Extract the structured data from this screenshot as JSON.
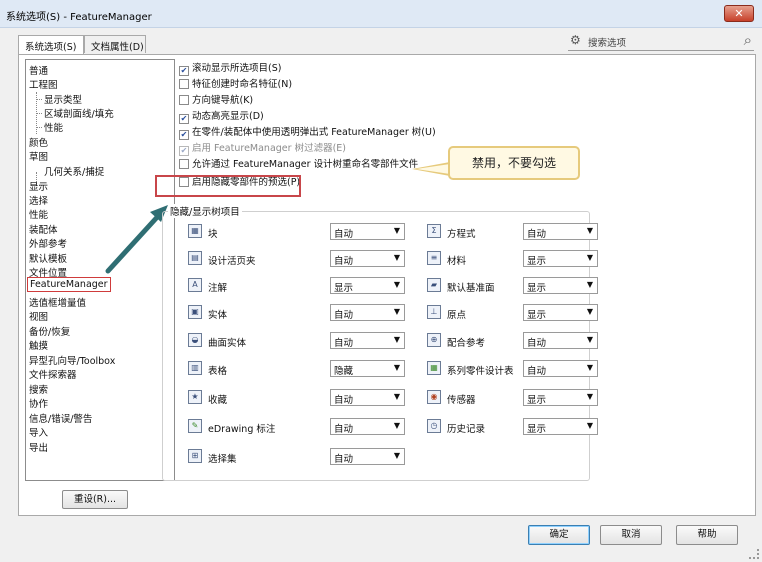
{
  "window": {
    "title": "系统选项(S) - FeatureManager",
    "close_label": "✕"
  },
  "tabs": [
    {
      "label": "系统选项(S)"
    },
    {
      "label": "文档属性(D)"
    }
  ],
  "search": {
    "placeholder": "搜索选项"
  },
  "nav": {
    "items": [
      {
        "label": "普通"
      },
      {
        "label": "工程图"
      },
      {
        "label": "显示类型"
      },
      {
        "label": "区域剖面线/填充"
      },
      {
        "label": "性能"
      },
      {
        "label": "颜色"
      },
      {
        "label": "草图"
      },
      {
        "label": "几何关系/捕捉"
      },
      {
        "label": "显示"
      },
      {
        "label": "选择"
      },
      {
        "label": "性能"
      },
      {
        "label": "装配体"
      },
      {
        "label": "外部参考"
      },
      {
        "label": "默认模板"
      },
      {
        "label": "文件位置"
      },
      {
        "label": "FeatureManager"
      },
      {
        "label": "选值框增量值"
      },
      {
        "label": "视图"
      },
      {
        "label": "备份/恢复"
      },
      {
        "label": "触摸"
      },
      {
        "label": "异型孔向导/Toolbox"
      },
      {
        "label": "文件探索器"
      },
      {
        "label": "搜索"
      },
      {
        "label": "协作"
      },
      {
        "label": "信息/错误/警告"
      },
      {
        "label": "导入"
      },
      {
        "label": "导出"
      }
    ],
    "reset_label": "重设(R)..."
  },
  "options": [
    {
      "label": "滚动显示所选项目(S)",
      "checked": true,
      "disabled": false
    },
    {
      "label": "特征创建时命名特征(N)",
      "checked": false,
      "disabled": false
    },
    {
      "label": "方向键导航(K)",
      "checked": false,
      "disabled": false
    },
    {
      "label": "动态高亮显示(D)",
      "checked": true,
      "disabled": false
    },
    {
      "label": "在零件/装配体中使用透明弹出式 FeatureManager 树(U)",
      "checked": true,
      "disabled": false
    },
    {
      "label": "启用 FeatureManager 树过滤器(E)",
      "checked": true,
      "disabled": true
    },
    {
      "label": "允许通过 FeatureManager 设计树重命名零部件文件",
      "checked": false,
      "disabled": false
    },
    {
      "label": "启用隐藏零部件的预选(P)",
      "checked": false,
      "disabled": false
    }
  ],
  "callout": {
    "text": "禁用，不要勾选"
  },
  "group": {
    "title": "隐藏/显示树项目",
    "items_left": [
      {
        "label": "块",
        "value": "自动",
        "icon": "block-icon"
      },
      {
        "label": "设计活页夹",
        "value": "自动",
        "icon": "design-binder-icon"
      },
      {
        "label": "注解",
        "value": "显示",
        "icon": "annotation-icon"
      },
      {
        "label": "实体",
        "value": "自动",
        "icon": "solid-body-icon"
      },
      {
        "label": "曲面实体",
        "value": "自动",
        "icon": "surface-body-icon"
      },
      {
        "label": "表格",
        "value": "隐藏",
        "icon": "table-icon"
      },
      {
        "label": "收藏",
        "value": "自动",
        "icon": "favorites-icon"
      },
      {
        "label": "eDrawing 标注",
        "value": "自动",
        "icon": "edrawing-markup-icon"
      },
      {
        "label": "选择集",
        "value": "自动",
        "icon": "selection-set-icon"
      }
    ],
    "items_right": [
      {
        "label": "方程式",
        "value": "自动",
        "icon": "equation-icon"
      },
      {
        "label": "材料",
        "value": "显示",
        "icon": "material-icon"
      },
      {
        "label": "默认基准面",
        "value": "显示",
        "icon": "default-plane-icon"
      },
      {
        "label": "原点",
        "value": "显示",
        "icon": "origin-icon"
      },
      {
        "label": "配合参考",
        "value": "自动",
        "icon": "mate-reference-icon"
      },
      {
        "label": "系列零件设计表",
        "value": "自动",
        "icon": "design-table-icon"
      },
      {
        "label": "传感器",
        "value": "显示",
        "icon": "sensor-icon"
      },
      {
        "label": "历史记录",
        "value": "显示",
        "icon": "history-icon"
      }
    ]
  },
  "footer": {
    "ok": "确定",
    "cancel": "取消",
    "help": "帮助"
  },
  "colors": {
    "highlight_red": "#c8464a",
    "callout_border": "#e6ca7c",
    "arrow": "#2f6e73"
  }
}
